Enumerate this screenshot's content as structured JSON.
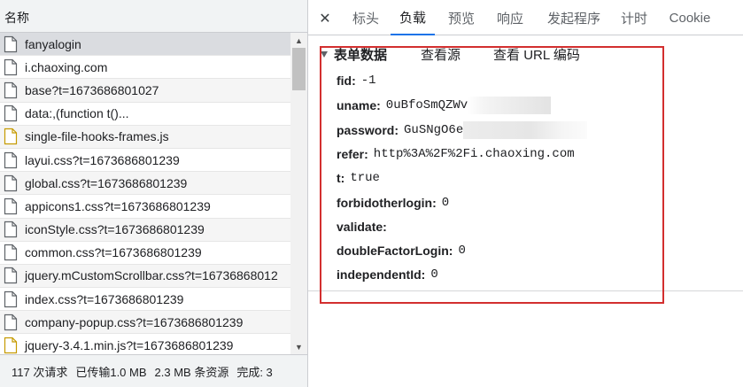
{
  "left_panel": {
    "column_header": "名称",
    "requests": [
      {
        "name": "fanyalogin",
        "icon": "document-icon"
      },
      {
        "name": "i.chaoxing.com",
        "icon": "document-icon"
      },
      {
        "name": "base?t=1673686801027",
        "icon": "document-icon"
      },
      {
        "name": "data:,(function t()...",
        "icon": "document-icon"
      },
      {
        "name": "single-file-hooks-frames.js",
        "icon": "script-icon"
      },
      {
        "name": "layui.css?t=1673686801239",
        "icon": "document-icon"
      },
      {
        "name": "global.css?t=1673686801239",
        "icon": "document-icon"
      },
      {
        "name": "appicons1.css?t=1673686801239",
        "icon": "document-icon"
      },
      {
        "name": "iconStyle.css?t=1673686801239",
        "icon": "document-icon"
      },
      {
        "name": "common.css?t=1673686801239",
        "icon": "document-icon"
      },
      {
        "name": "jquery.mCustomScrollbar.css?t=16736868012",
        "icon": "document-icon"
      },
      {
        "name": "index.css?t=1673686801239",
        "icon": "document-icon"
      },
      {
        "name": "company-popup.css?t=1673686801239",
        "icon": "document-icon"
      },
      {
        "name": "jquery-3.4.1.min.js?t=1673686801239",
        "icon": "script-icon"
      }
    ],
    "status": {
      "requests": "117 次请求",
      "transferred": "已传输1.0 MB",
      "resources": "2.3 MB 条资源",
      "finish": "完成: 3"
    }
  },
  "right_panel": {
    "close_icon": "close-icon",
    "tabs": [
      {
        "label": "标头",
        "active": false
      },
      {
        "label": "负载",
        "active": true
      },
      {
        "label": "预览",
        "active": false
      },
      {
        "label": "响应",
        "active": false
      },
      {
        "label": "发起程序",
        "active": false
      },
      {
        "label": "计时",
        "active": false
      },
      {
        "label": "Cookie",
        "active": false
      }
    ],
    "form_section": {
      "title": "表单数据",
      "view_source": "查看源",
      "view_url_encoded": "查看 URL 编码",
      "params": [
        {
          "key": "fid:",
          "value": "-1"
        },
        {
          "key": "uname:",
          "value": "0uBfoSmQZWv"
        },
        {
          "key": "password:",
          "value": "GuSNgO6e"
        },
        {
          "key": "refer:",
          "value": "http%3A%2F%2Fi.chaoxing.com"
        },
        {
          "key": "t:",
          "value": "true"
        },
        {
          "key": "forbidotherlogin:",
          "value": "0"
        },
        {
          "key": "validate:",
          "value": ""
        },
        {
          "key": "doubleFactorLogin:",
          "value": "0"
        },
        {
          "key": "independentId:",
          "value": "0"
        }
      ]
    }
  },
  "colors": {
    "highlight_border": "#d32f2f",
    "active_tab_underline": "#1a73e8",
    "selected_row": "#dadce0"
  }
}
